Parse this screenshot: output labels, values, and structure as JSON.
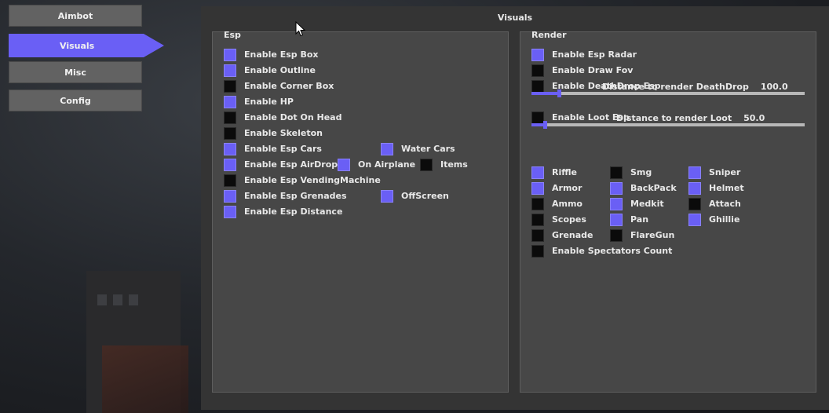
{
  "nav": [
    {
      "label": "Aimbot",
      "active": false
    },
    {
      "label": "Visuals",
      "active": true
    },
    {
      "label": "Misc",
      "active": false
    },
    {
      "label": "Config",
      "active": false
    }
  ],
  "main": {
    "title": "Visuals"
  },
  "esp": {
    "title": "Esp",
    "items": [
      {
        "label": "Enable Esp Box",
        "checked": true
      },
      {
        "label": "Enable Outline",
        "checked": true
      },
      {
        "label": "Enable Corner Box",
        "checked": false
      },
      {
        "label": "Enable HP",
        "checked": true
      },
      {
        "label": "Enable Dot On Head",
        "checked": false
      },
      {
        "label": "Enable Skeleton",
        "checked": false
      },
      {
        "label": "Enable Esp Cars",
        "checked": true
      },
      {
        "label": "Water Cars",
        "checked": true
      },
      {
        "label": "Enable Esp AirDrop",
        "checked": true
      },
      {
        "label": "On Airplane",
        "checked": true
      },
      {
        "label": "Items",
        "checked": false
      },
      {
        "label": "Enable Esp VendingMachine",
        "checked": false
      },
      {
        "label": "Enable Esp Grenades",
        "checked": true
      },
      {
        "label": "OffScreen",
        "checked": true
      },
      {
        "label": "Enable Esp Distance",
        "checked": true
      }
    ]
  },
  "render": {
    "title": "Render",
    "items": [
      {
        "label": "Enable Esp Radar",
        "checked": true
      },
      {
        "label": "Enable Draw Fov",
        "checked": false
      },
      {
        "label": "Enable DeathDrop Esp",
        "checked": false
      },
      {
        "label": "Enable Loot Esp",
        "checked": false
      },
      {
        "label": "Riffle",
        "checked": true
      },
      {
        "label": "Smg",
        "checked": false
      },
      {
        "label": "Sniper",
        "checked": true
      },
      {
        "label": "Armor",
        "checked": true
      },
      {
        "label": "BackPack",
        "checked": true
      },
      {
        "label": "Helmet",
        "checked": true
      },
      {
        "label": "Ammo",
        "checked": false
      },
      {
        "label": "Medkit",
        "checked": true
      },
      {
        "label": "Attach",
        "checked": false
      },
      {
        "label": "Scopes",
        "checked": false
      },
      {
        "label": "Pan",
        "checked": true
      },
      {
        "label": "Ghillie",
        "checked": true
      },
      {
        "label": "Grenade",
        "checked": false
      },
      {
        "label": "FlareGun",
        "checked": false
      },
      {
        "label": "Enable Spectators Count",
        "checked": false
      }
    ],
    "sliders": [
      {
        "label": "Distance to render DeathDrop",
        "value": "100.0",
        "fraction": 0.1
      },
      {
        "label": "Distance to render Loot",
        "value": "50.0",
        "fraction": 0.05
      }
    ]
  },
  "colors": {
    "accent": "#6a5ff5",
    "unchecked": "#0b0b0b",
    "panel": "#343434",
    "group": "#474747"
  }
}
